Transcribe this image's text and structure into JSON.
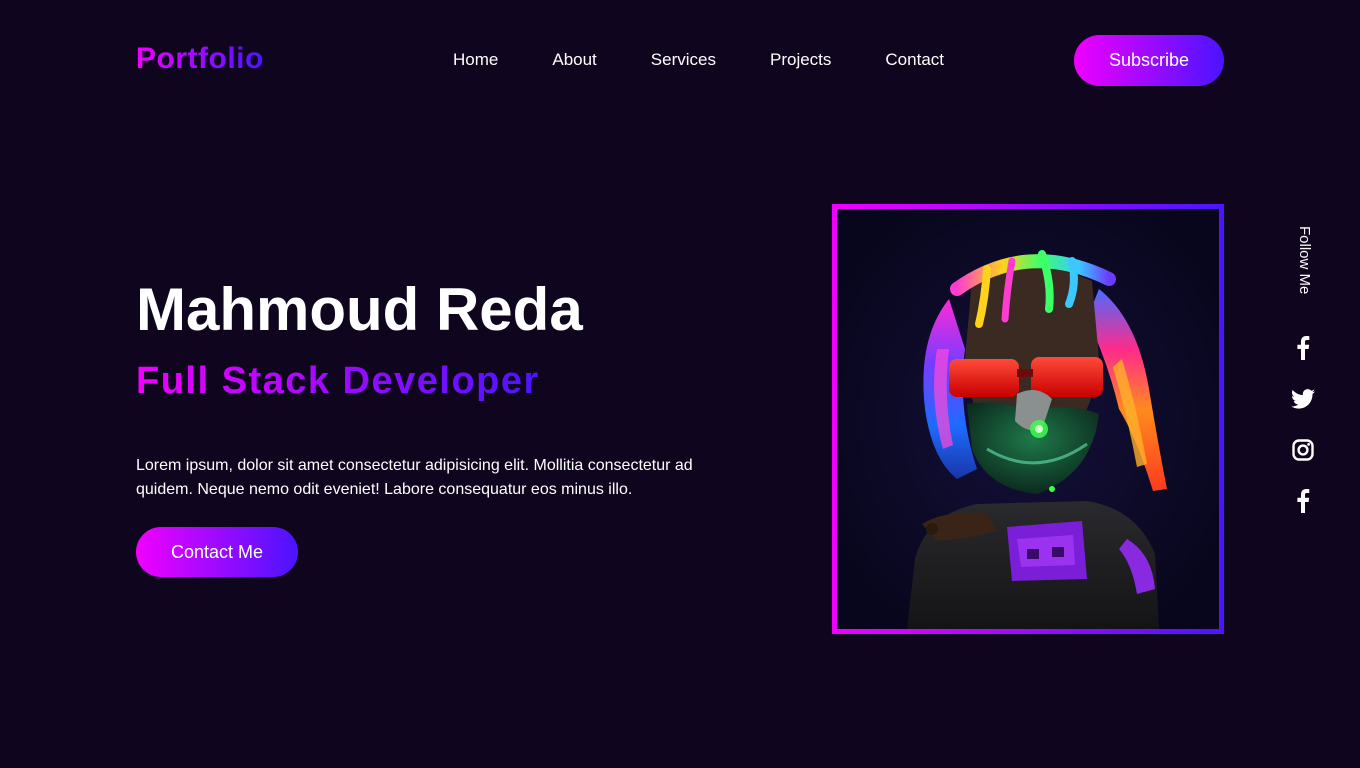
{
  "header": {
    "logo": "Portfolio",
    "nav": [
      "Home",
      "About",
      "Services",
      "Projects",
      "Contact"
    ],
    "subscribe_label": "Subscribe"
  },
  "hero": {
    "name": "Mahmoud Reda",
    "role": "Full Stack Developer",
    "description": "Lorem ipsum, dolor sit amet consectetur adipisicing elit. Mollitia consectetur ad quidem. Neque nemo odit eveniet! Labore consequatur eos minus illo.",
    "contact_label": "Contact Me"
  },
  "sidebar": {
    "follow_label": "Follow Me",
    "social_icons": [
      "facebook-icon",
      "twitter-icon",
      "instagram-icon",
      "facebook-icon"
    ]
  },
  "colors": {
    "background": "#10051f",
    "gradient_start": "#f000ff",
    "gradient_end": "#4a14ff",
    "text": "#ffffff"
  }
}
